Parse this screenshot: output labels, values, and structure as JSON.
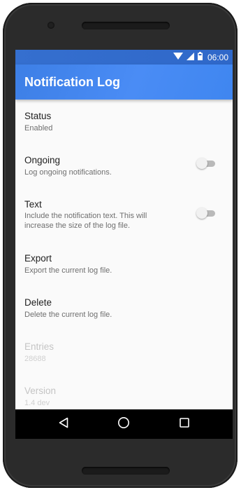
{
  "status_bar": {
    "time": "06:00",
    "icons": [
      "wifi-icon",
      "cell-signal-icon",
      "battery-icon"
    ]
  },
  "app": {
    "title": "Notification Log",
    "accent_color": "#4285f4"
  },
  "settings": [
    {
      "title": "Status",
      "summary": "Enabled",
      "toggle": null,
      "enabled": true
    },
    {
      "title": "Ongoing",
      "summary": "Log ongoing notifications.",
      "toggle": false,
      "enabled": true
    },
    {
      "title": "Text",
      "summary": "Include the notification text. This will increase the size of the log file.",
      "toggle": false,
      "enabled": true
    },
    {
      "title": "Export",
      "summary": "Export the current log file.",
      "toggle": null,
      "enabled": true
    },
    {
      "title": "Delete",
      "summary": "Delete the current log file.",
      "toggle": null,
      "enabled": true
    },
    {
      "title": "Entries",
      "summary": "28688",
      "toggle": null,
      "enabled": false
    },
    {
      "title": "Version",
      "summary": "1.4 dev",
      "toggle": null,
      "enabled": false
    }
  ],
  "nav_bar": {
    "buttons": [
      "back-icon",
      "home-icon",
      "recents-icon"
    ]
  }
}
